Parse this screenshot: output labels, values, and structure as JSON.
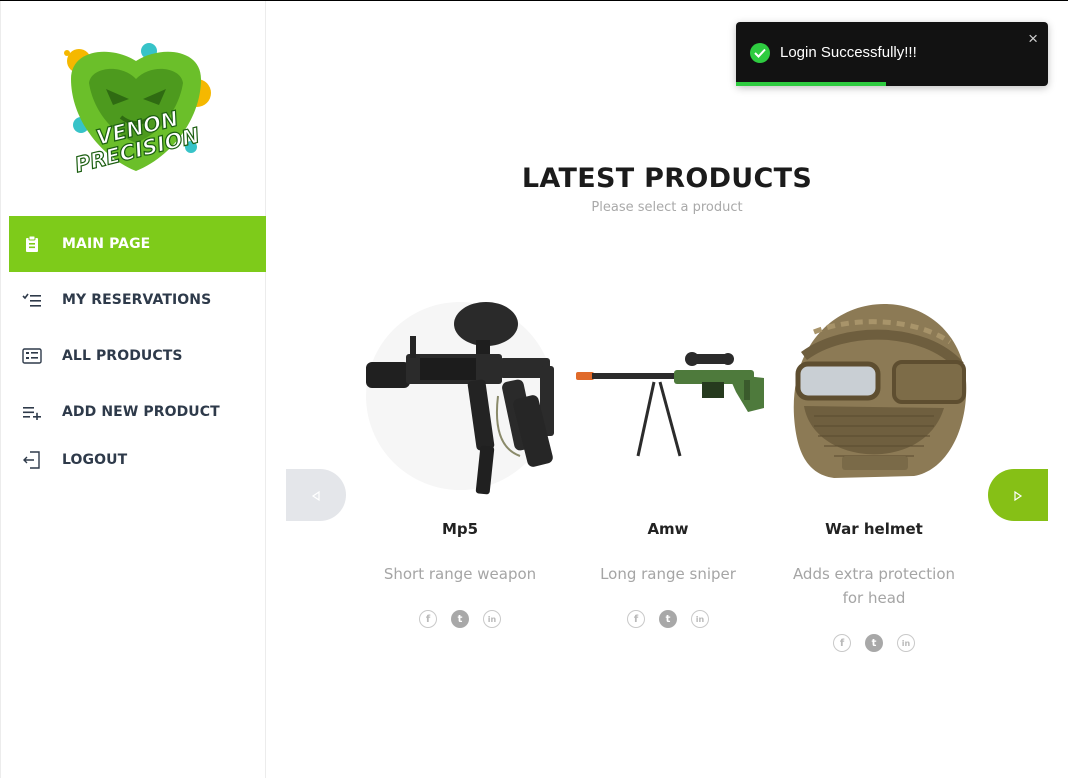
{
  "brand": {
    "logo_text_line1": "VENON",
    "logo_text_line2": "PRECISION",
    "logo_alt": "Venon Precision logo"
  },
  "sidebar": {
    "items": [
      {
        "label": "MAIN PAGE",
        "icon": "clipboard-icon",
        "active": true
      },
      {
        "label": "MY RESERVATIONS",
        "icon": "checklist-icon",
        "active": false
      },
      {
        "label": "ALL PRODUCTS",
        "icon": "list-card-icon",
        "active": false
      },
      {
        "label": "ADD NEW PRODUCT",
        "icon": "add-list-icon",
        "active": false
      },
      {
        "label": "LOGOUT",
        "icon": "logout-icon",
        "active": false
      }
    ]
  },
  "main": {
    "title": "LATEST PRODUCTS",
    "subtitle": "Please select a product",
    "products": [
      {
        "name": "Mp5",
        "description": "Short range weapon",
        "image": "paintball-marker"
      },
      {
        "name": "Amw",
        "description": "Long range sniper",
        "image": "sniper-rifle"
      },
      {
        "name": "War helmet",
        "description": "Adds extra protection for head",
        "image": "tactical-helmet"
      }
    ],
    "socials": [
      "facebook-icon",
      "twitter-icon",
      "linkedin-icon"
    ]
  },
  "toast": {
    "message": "Login Successfully!!!",
    "close_glyph": "×",
    "progress_percent": 48,
    "progress_color": "#2ecc40"
  },
  "colors": {
    "accent": "#7ecb1a",
    "arrow_right": "#86c016",
    "toast_bg": "#121212"
  }
}
